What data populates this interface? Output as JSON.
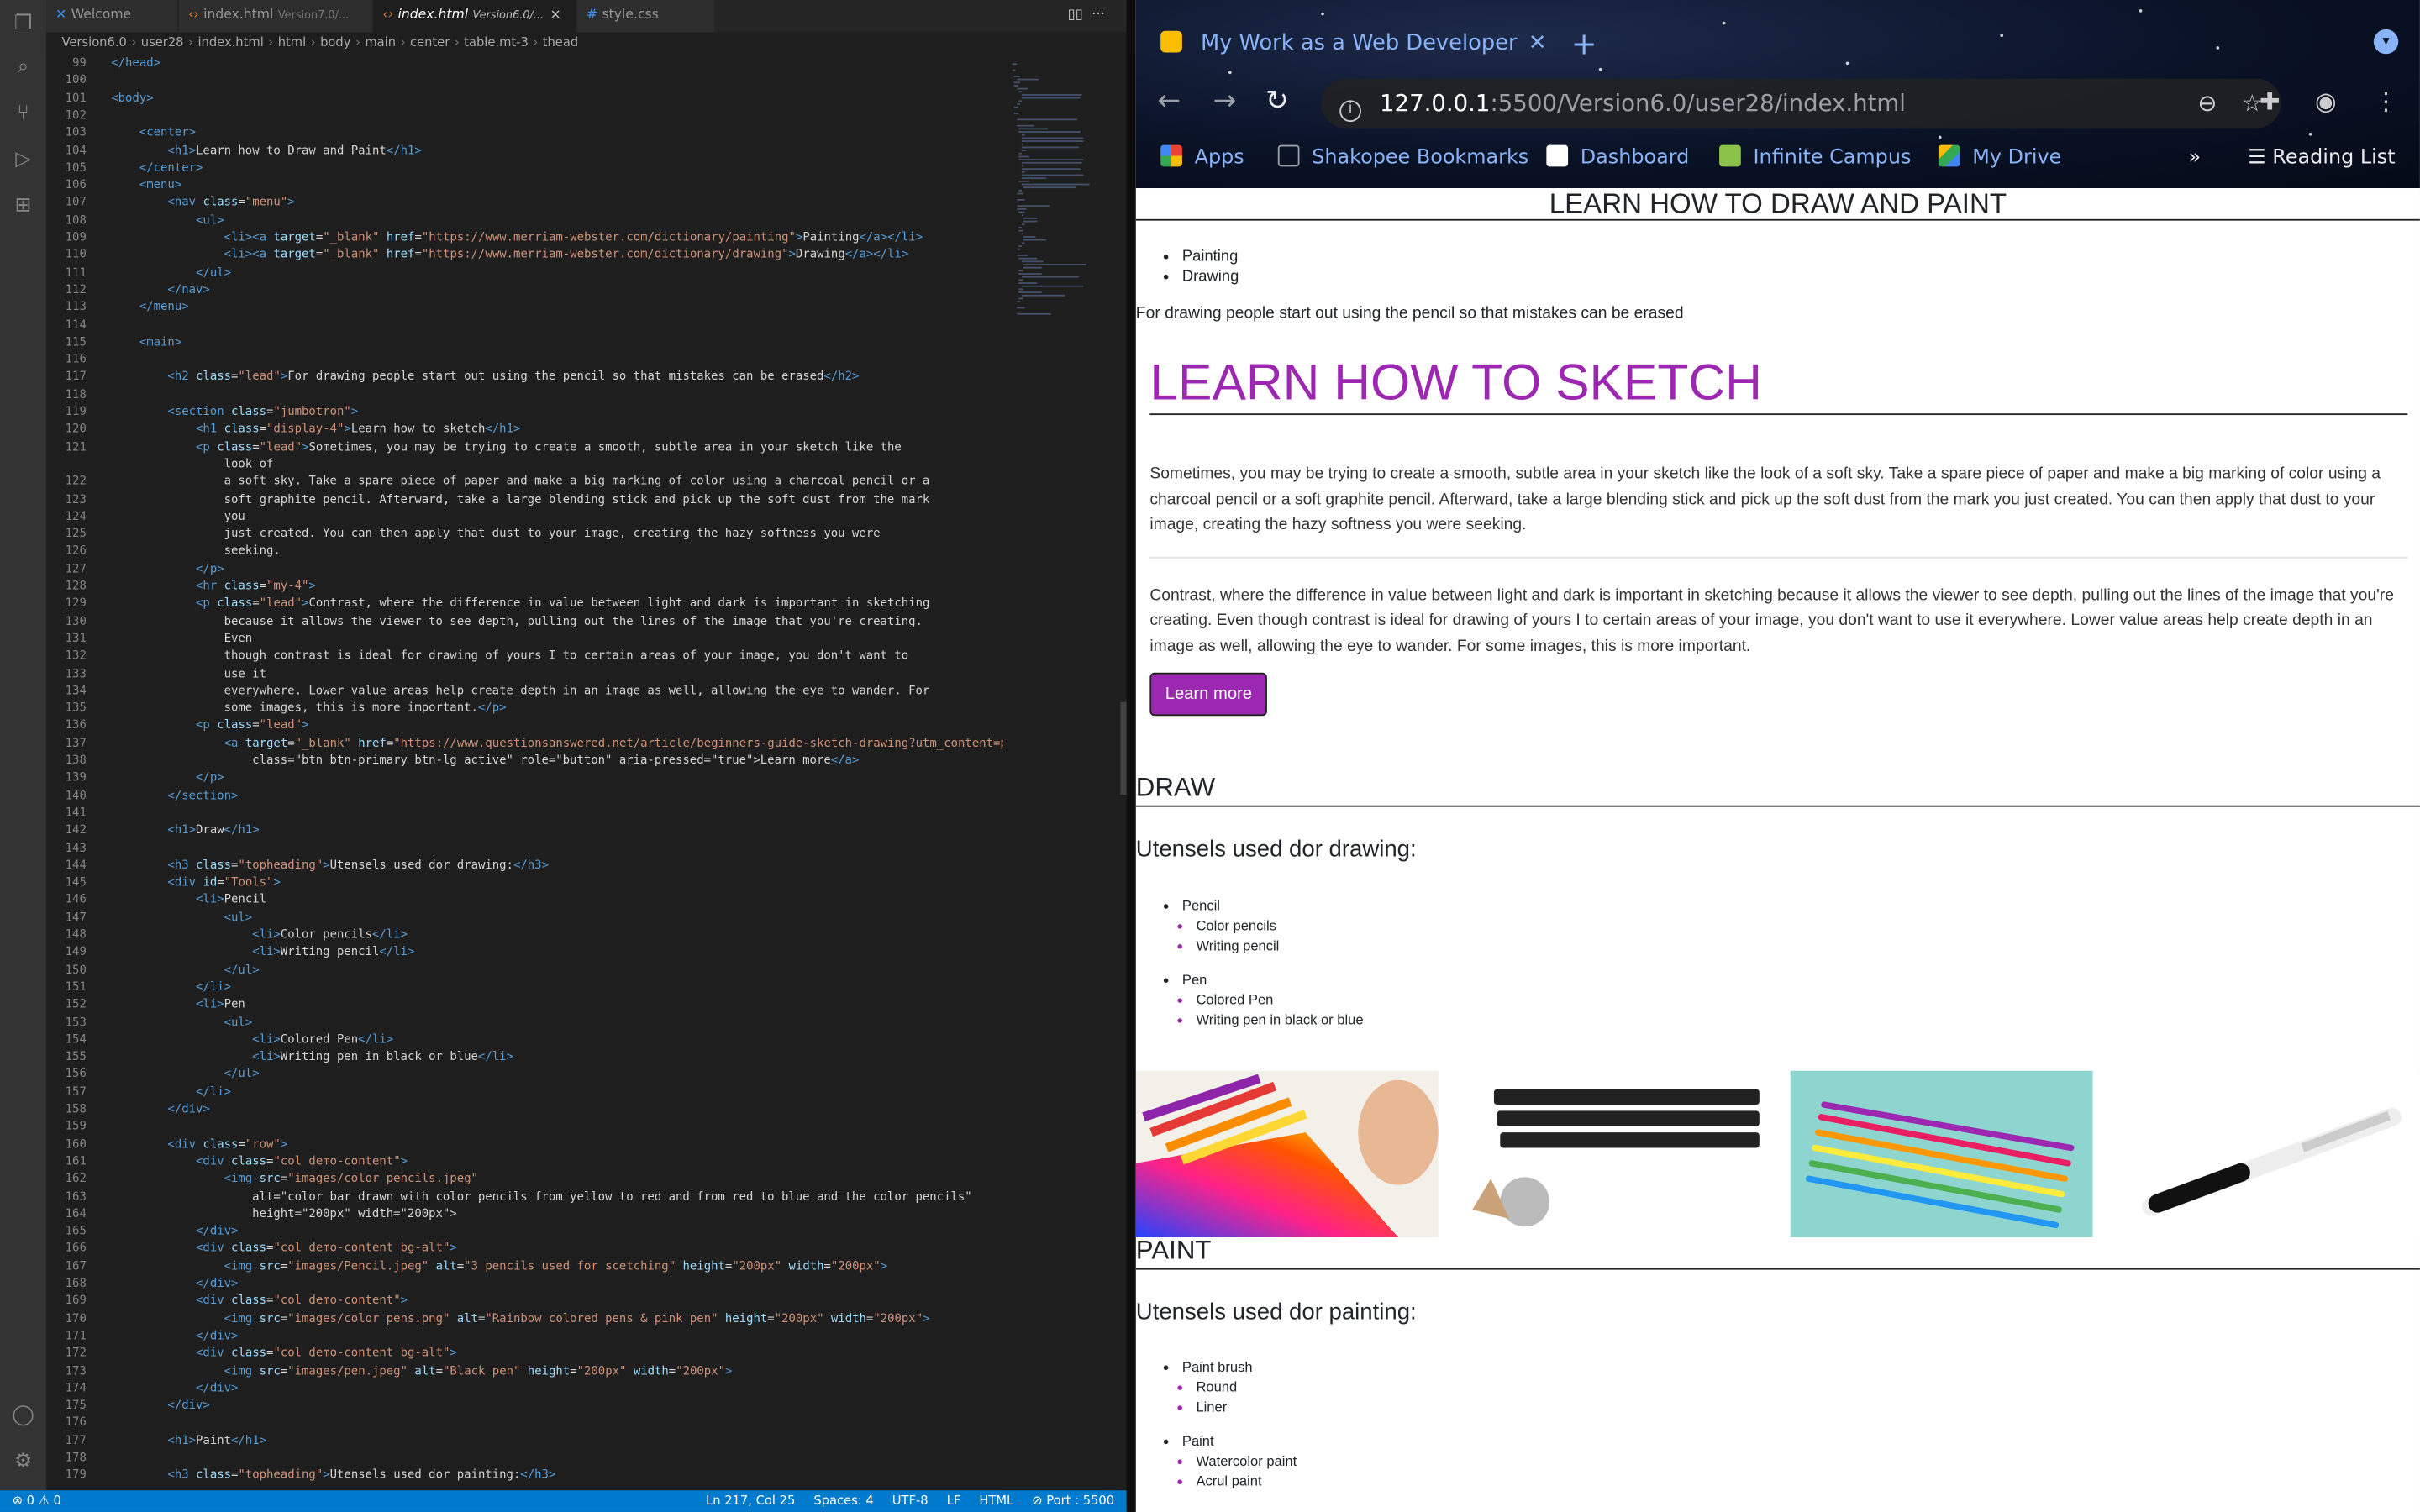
{
  "editor": {
    "tabs": [
      {
        "label": "Welcome",
        "sub": ""
      },
      {
        "label": "index.html",
        "sub": "Version7.0/..."
      },
      {
        "label": "index.html",
        "sub": "Version6.0/..."
      },
      {
        "label": "style.css",
        "sub": ""
      }
    ],
    "breadcrumb": [
      "Version6.0",
      "user28",
      "index.html",
      "html",
      "body",
      "main",
      "center",
      "table.mt-3",
      "thead"
    ],
    "lines": [
      {
        "n": "99",
        "c": "</head>"
      },
      {
        "n": "100",
        "c": ""
      },
      {
        "n": "101",
        "c": "<body>"
      },
      {
        "n": "102",
        "c": ""
      },
      {
        "n": "103",
        "c": "    <center>"
      },
      {
        "n": "104",
        "c": "        <h1>Learn how to Draw and Paint</h1>"
      },
      {
        "n": "105",
        "c": "    </center>"
      },
      {
        "n": "106",
        "c": "    <menu>"
      },
      {
        "n": "107",
        "c": "        <nav class=\"menu\">"
      },
      {
        "n": "108",
        "c": "            <ul>"
      },
      {
        "n": "109",
        "c": "                <li><a target=\"_blank\" href=\"https://www.merriam-webster.com/dictionary/painting\">Painting</a></li>"
      },
      {
        "n": "110",
        "c": "                <li><a target=\"_blank\" href=\"https://www.merriam-webster.com/dictionary/drawing\">Drawing</a></li>"
      },
      {
        "n": "111",
        "c": "            </ul>"
      },
      {
        "n": "112",
        "c": "        </nav>"
      },
      {
        "n": "113",
        "c": "    </menu>"
      },
      {
        "n": "114",
        "c": ""
      },
      {
        "n": "115",
        "c": "    <main>"
      },
      {
        "n": "116",
        "c": ""
      },
      {
        "n": "117",
        "c": "        <h2 class=\"lead\">For drawing people start out using the pencil so that mistakes can be erased</h2>"
      },
      {
        "n": "118",
        "c": ""
      },
      {
        "n": "119",
        "c": "        <section class=\"jumbotron\">"
      },
      {
        "n": "120",
        "c": "            <h1 class=\"display-4\">Learn how to sketch</h1>"
      },
      {
        "n": "121",
        "c": "            <p class=\"lead\">Sometimes, you may be trying to create a smooth, subtle area in your sketch like the"
      },
      {
        "n": "",
        "c": "                look of"
      },
      {
        "n": "122",
        "c": "                a soft sky. Take a spare piece of paper and make a big marking of color using a charcoal pencil or a"
      },
      {
        "n": "123",
        "c": "                soft graphite pencil. Afterward, take a large blending stick and pick up the soft dust from the mark"
      },
      {
        "n": "124",
        "c": "                you"
      },
      {
        "n": "125",
        "c": "                just created. You can then apply that dust to your image, creating the hazy softness you were"
      },
      {
        "n": "126",
        "c": "                seeking."
      },
      {
        "n": "127",
        "c": "            </p>"
      },
      {
        "n": "128",
        "c": "            <hr class=\"my-4\">"
      },
      {
        "n": "129",
        "c": "            <p class=\"lead\">Contrast, where the difference in value between light and dark is important in sketching"
      },
      {
        "n": "130",
        "c": "                because it allows the viewer to see depth, pulling out the lines of the image that you're creating."
      },
      {
        "n": "131",
        "c": "                Even"
      },
      {
        "n": "132",
        "c": "                though contrast is ideal for drawing of yours I to certain areas of your image, you don't want to"
      },
      {
        "n": "133",
        "c": "                use it"
      },
      {
        "n": "134",
        "c": "                everywhere. Lower value areas help create depth in an image as well, allowing the eye to wander. For"
      },
      {
        "n": "135",
        "c": "                some images, this is more important.</p>"
      },
      {
        "n": "136",
        "c": "            <p class=\"lead\">"
      },
      {
        "n": "137",
        "c": "                <a target=\"_blank\" href=\"https://www.questionsanswered.net/article/beginners-guide-sketch-drawing?utm_content=pa"
      },
      {
        "n": "138",
        "c": "                    class=\"btn btn-primary btn-lg active\" role=\"button\" aria-pressed=\"true\">Learn more</a>"
      },
      {
        "n": "139",
        "c": "            </p>"
      },
      {
        "n": "140",
        "c": "        </section>"
      },
      {
        "n": "141",
        "c": ""
      },
      {
        "n": "142",
        "c": "        <h1>Draw</h1>"
      },
      {
        "n": "143",
        "c": ""
      },
      {
        "n": "144",
        "c": "        <h3 class=\"topheading\">Utensels used dor drawing:</h3>"
      },
      {
        "n": "145",
        "c": "        <div id=\"Tools\">"
      },
      {
        "n": "146",
        "c": "            <li>Pencil"
      },
      {
        "n": "147",
        "c": "                <ul>"
      },
      {
        "n": "148",
        "c": "                    <li>Color pencils</li>"
      },
      {
        "n": "149",
        "c": "                    <li>Writing pencil</li>"
      },
      {
        "n": "150",
        "c": "                </ul>"
      },
      {
        "n": "151",
        "c": "            </li>"
      },
      {
        "n": "152",
        "c": "            <li>Pen"
      },
      {
        "n": "153",
        "c": "                <ul>"
      },
      {
        "n": "154",
        "c": "                    <li>Colored Pen</li>"
      },
      {
        "n": "155",
        "c": "                    <li>Writing pen in black or blue</li>"
      },
      {
        "n": "156",
        "c": "                </ul>"
      },
      {
        "n": "157",
        "c": "            </li>"
      },
      {
        "n": "158",
        "c": "        </div>"
      },
      {
        "n": "159",
        "c": ""
      },
      {
        "n": "160",
        "c": "        <div class=\"row\">"
      },
      {
        "n": "161",
        "c": "            <div class=\"col demo-content\">"
      },
      {
        "n": "162",
        "c": "                <img src=\"images/color pencils.jpeg\""
      },
      {
        "n": "163",
        "c": "                    alt=\"color bar drawn with color pencils from yellow to red and from red to blue and the color pencils\""
      },
      {
        "n": "164",
        "c": "                    height=\"200px\" width=\"200px\">"
      },
      {
        "n": "165",
        "c": "            </div>"
      },
      {
        "n": "166",
        "c": "            <div class=\"col demo-content bg-alt\">"
      },
      {
        "n": "167",
        "c": "                <img src=\"images/Pencil.jpeg\" alt=\"3 pencils used for scetching\" height=\"200px\" width=\"200px\">"
      },
      {
        "n": "168",
        "c": "            </div>"
      },
      {
        "n": "169",
        "c": "            <div class=\"col demo-content\">"
      },
      {
        "n": "170",
        "c": "                <img src=\"images/color pens.png\" alt=\"Rainbow colored pens & pink pen\" height=\"200px\" width=\"200px\">"
      },
      {
        "n": "171",
        "c": "            </div>"
      },
      {
        "n": "172",
        "c": "            <div class=\"col demo-content bg-alt\">"
      },
      {
        "n": "173",
        "c": "                <img src=\"images/pen.jpeg\" alt=\"Black pen\" height=\"200px\" width=\"200px\">"
      },
      {
        "n": "174",
        "c": "            </div>"
      },
      {
        "n": "175",
        "c": "        </div>"
      },
      {
        "n": "176",
        "c": ""
      },
      {
        "n": "177",
        "c": "        <h1>Paint</h1>"
      },
      {
        "n": "178",
        "c": ""
      },
      {
        "n": "179",
        "c": "        <h3 class=\"topheading\">Utensels used dor painting:</h3>"
      }
    ],
    "status_left": "⊗ 0 ⚠ 0",
    "status_right": [
      "Ln 217, Col 25",
      "Spaces: 4",
      "UTF-8",
      "LF",
      "HTML",
      "⊘ Port : 5500"
    ]
  },
  "browser": {
    "tab_title": "My Work as a Web Developer",
    "url_host": "127.0.0.1",
    "url_rest": ":5500/Version6.0/user28/index.html",
    "bookmarks": [
      "Apps",
      "Shakopee Bookmarks",
      "Dashboard",
      "Infinite Campus",
      "My Drive"
    ],
    "reading_list": "Reading List",
    "page": {
      "title": "LEARN HOW TO DRAW AND PAINT",
      "menu": [
        "Painting",
        "Drawing"
      ],
      "lead": "For drawing people start out using the pencil so that mistakes can be erased",
      "jumbo_title": "LEARN HOW TO SKETCH",
      "p1": "Sometimes, you may be trying to create a smooth, subtle area in your sketch like the look of a soft sky. Take a spare piece of paper and make a big marking of color using a charcoal pencil or a soft graphite pencil. Afterward, take a large blending stick and pick up the soft dust from the mark you just created. You can then apply that dust to your image, creating the hazy softness you were seeking.",
      "p2": "Contrast, where the difference in value between light and dark is important in sketching because it allows the viewer to see depth, pulling out the lines of the image that you're creating. Even though contrast is ideal for drawing of yours I to certain areas of your image, you don't want to use it everywhere. Lower value areas help create depth in an image as well, allowing the eye to wander. For some images, this is more important.",
      "learn_more": "Learn more",
      "draw": "DRAW",
      "draw_heading": "Utensels used dor drawing:",
      "draw_tools": [
        {
          "name": "Pencil",
          "items": [
            "Color pencils",
            "Writing pencil"
          ]
        },
        {
          "name": "Pen",
          "items": [
            "Colored Pen",
            "Writing pen in black or blue"
          ]
        }
      ],
      "paint": "PAINT",
      "paint_heading": "Utensels used dor painting:",
      "paint_tools": [
        {
          "name": "Paint brush",
          "items": [
            "Round",
            "Liner"
          ]
        },
        {
          "name": "Paint",
          "items": [
            "Watercolor paint",
            "Acrul paint"
          ]
        }
      ]
    }
  },
  "colors": {
    "accent": "#9c27b0",
    "statusbar": "#007acc",
    "chrome_link": "#8ab4f8"
  }
}
